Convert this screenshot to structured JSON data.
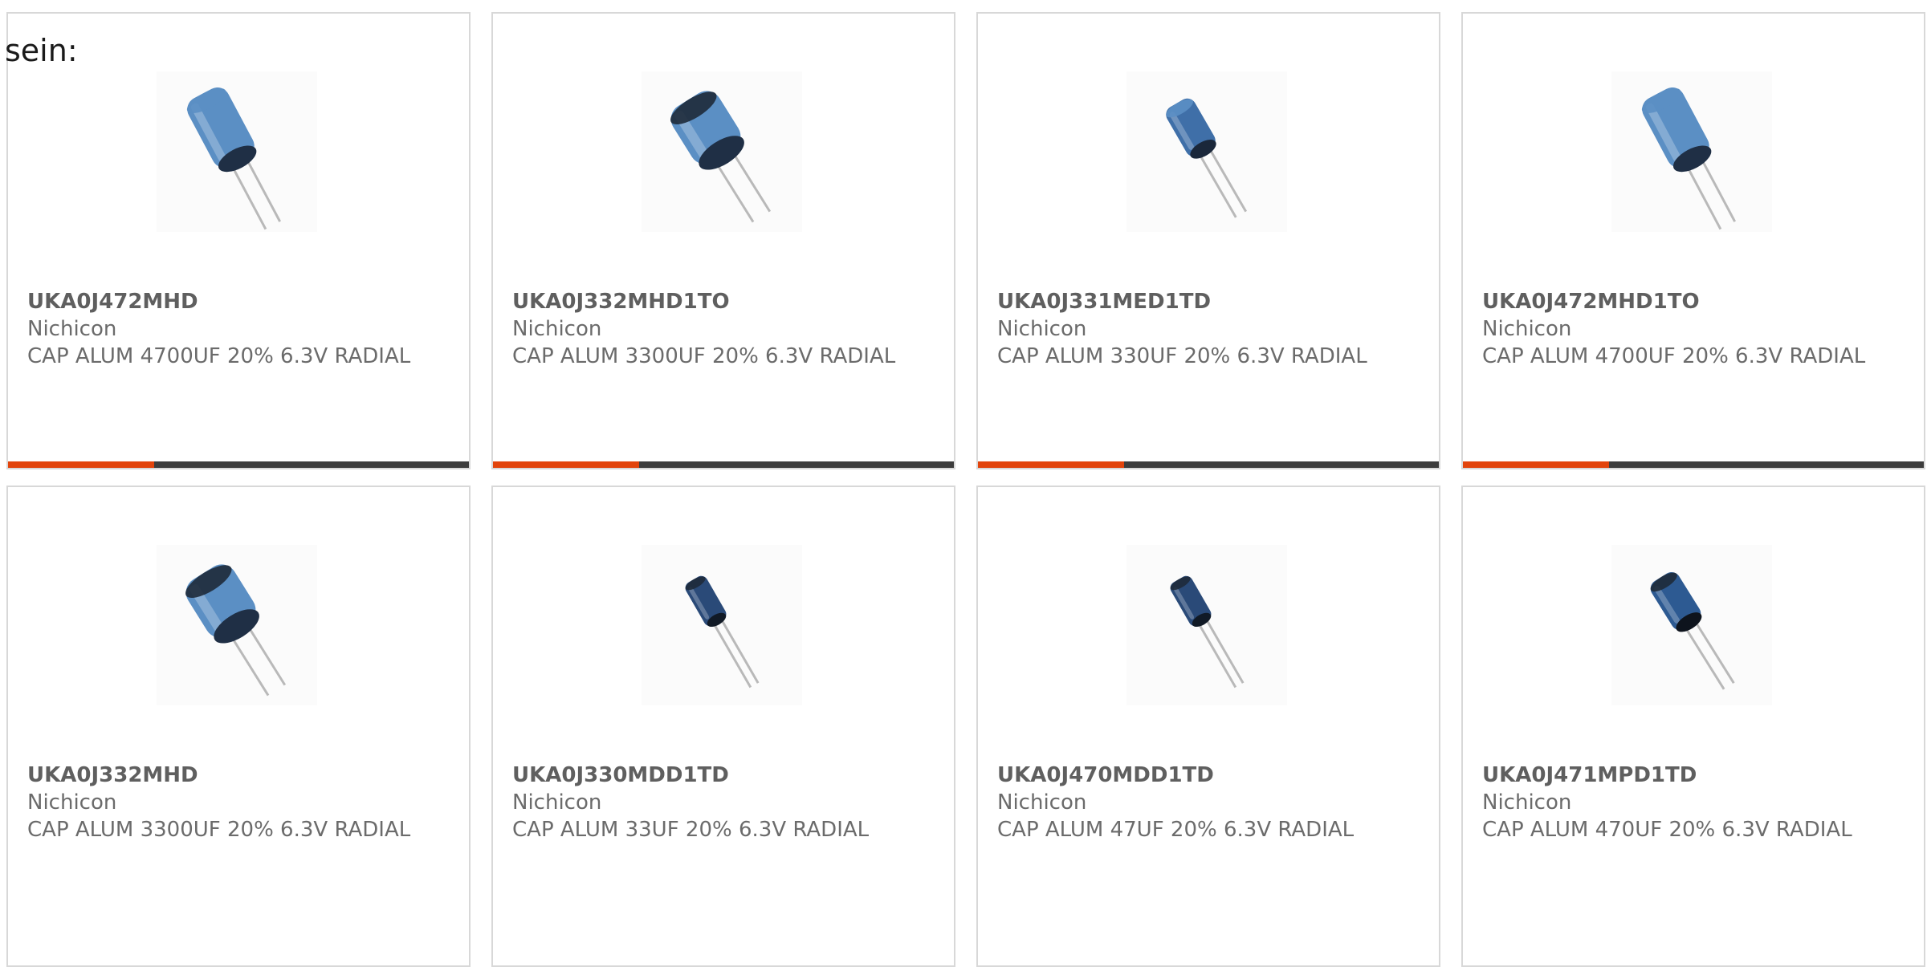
{
  "intro_text": "sein:",
  "products": [
    {
      "part": "UKA0J472MHD",
      "maker": "Nichicon",
      "desc": "CAP ALUM 4700UF 20% 6.3V RADIAL",
      "image": "capacitor-large-icon"
    },
    {
      "part": "UKA0J332MHD1TO",
      "maker": "Nichicon",
      "desc": "CAP ALUM 3300UF 20% 6.3V RADIAL",
      "image": "capacitor-wide-icon"
    },
    {
      "part": "UKA0J331MED1TD",
      "maker": "Nichicon",
      "desc": "CAP ALUM 330UF 20% 6.3V RADIAL",
      "image": "capacitor-medium-icon"
    },
    {
      "part": "UKA0J472MHD1TO",
      "maker": "Nichicon",
      "desc": "CAP ALUM 4700UF 20% 6.3V RADIAL",
      "image": "capacitor-large-icon"
    },
    {
      "part": "UKA0J332MHD",
      "maker": "Nichicon",
      "desc": "CAP ALUM 3300UF 20% 6.3V RADIAL",
      "image": "capacitor-wide-icon"
    },
    {
      "part": "UKA0J330MDD1TD",
      "maker": "Nichicon",
      "desc": "CAP ALUM 33UF 20% 6.3V RADIAL",
      "image": "capacitor-small-icon"
    },
    {
      "part": "UKA0J470MDD1TD",
      "maker": "Nichicon",
      "desc": "CAP ALUM 47UF 20% 6.3V RADIAL",
      "image": "capacitor-small-icon"
    },
    {
      "part": "UKA0J471MPD1TD",
      "maker": "Nichicon",
      "desc": "CAP ALUM 470UF 20% 6.3V RADIAL",
      "image": "capacitor-small-dark-icon"
    }
  ],
  "colors": {
    "accent": "#e2440c",
    "bar": "#3d3d3d",
    "capacitor_blue": "#5b8fc4",
    "capacitor_dark": "#1e2a3a"
  }
}
